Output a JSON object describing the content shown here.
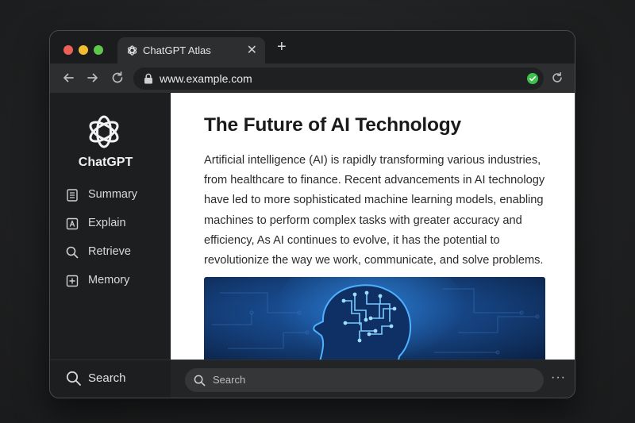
{
  "tab": {
    "title": "ChatGPT Atlas",
    "close": "✕",
    "new_tab": "+"
  },
  "toolbar": {
    "url": "www.example.com"
  },
  "sidebar": {
    "brand": "ChatGPT",
    "items": [
      {
        "label": "Summary",
        "icon": "document-icon"
      },
      {
        "label": "Explain",
        "icon": "letter-a-icon"
      },
      {
        "label": "Retrieve",
        "icon": "search-icon"
      },
      {
        "label": "Memory",
        "icon": "plus-box-icon"
      }
    ],
    "search_label": "Search"
  },
  "article": {
    "title": "The Future of AI Technology",
    "body": "Artificial intelligence (AI) is rapidly transforming various industries, from healthcare to finance. Recent advancements in AI technology have led to more sophisticated machine learning models, enabling machines to perform complex tasks with greater accuracy and efficiency, As AI continues to evolve, it has the potential to revolutionize the way we work, communicate, and solve problems."
  },
  "bottom_search": {
    "placeholder": "Search",
    "more": "···"
  },
  "colors": {
    "traffic_red": "#ee5f57",
    "traffic_yellow": "#f3bd2e",
    "traffic_green": "#5fc74b",
    "secure_check": "#3fbf4f",
    "hero_blue": "#1c4f9a"
  }
}
